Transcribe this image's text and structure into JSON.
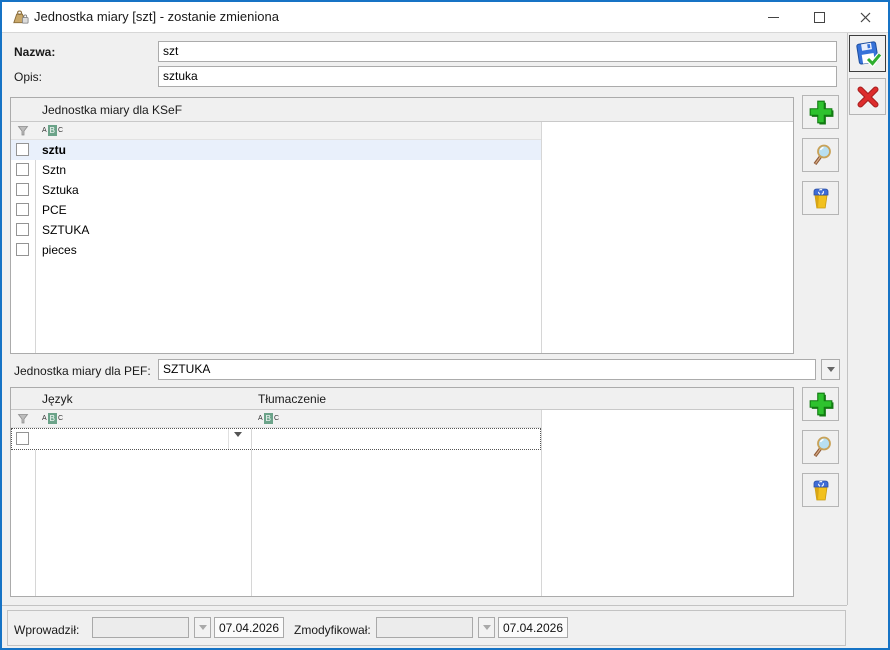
{
  "window": {
    "title": "Jednostka miary [szt] - zostanie zmieniona"
  },
  "form": {
    "nazwa": {
      "label": "Nazwa:",
      "value": "szt"
    },
    "opis": {
      "label": "Opis:",
      "value": "sztuka"
    },
    "pef": {
      "label": "Jednostka miary dla PEF:",
      "value": "SZTUKA"
    }
  },
  "ksef_table": {
    "header": "Jednostka miary dla KSeF",
    "rows": [
      {
        "label": "sztu",
        "selected": true,
        "checked": false
      },
      {
        "label": "Sztn",
        "selected": false,
        "checked": false
      },
      {
        "label": "Sztuka",
        "selected": false,
        "checked": false
      },
      {
        "label": "PCE",
        "selected": false,
        "checked": false
      },
      {
        "label": "SZTUKA",
        "selected": false,
        "checked": false
      },
      {
        "label": "pieces",
        "selected": false,
        "checked": false
      }
    ]
  },
  "translation_table": {
    "col_jezyk": "Język",
    "col_tlumaczenie": "Tłumaczenie"
  },
  "footer": {
    "wprowadzil": {
      "label": "Wprowadził:",
      "value": "",
      "date": "07.04.2026"
    },
    "zmodyfikowal": {
      "label": "Zmodyfikował:",
      "value": "",
      "date": "07.04.2026"
    }
  },
  "icons": {
    "abc_letters": [
      "A",
      "B",
      "C"
    ],
    "title_icon": "unit-of-measure-icon",
    "save": "save-icon",
    "cancel": "cancel-icon",
    "add": "plus-icon",
    "magnifier": "magnifier-icon",
    "trash": "trash-icon",
    "filter": "funnel-icon"
  },
  "colors": {
    "window_border": "#1673c5",
    "titlebar_bg": "#ffffff",
    "content_bg": "#f0f0f0",
    "selection_bg": "#e9f0fb",
    "abc_green": "#6ba389",
    "add_green": "#2ec22e",
    "cancel_red": "#dd2c2c",
    "save_blue": "#3672d9",
    "trash_yellow": "#f2c11e",
    "trash_lid_blue": "#3f6cd6"
  }
}
